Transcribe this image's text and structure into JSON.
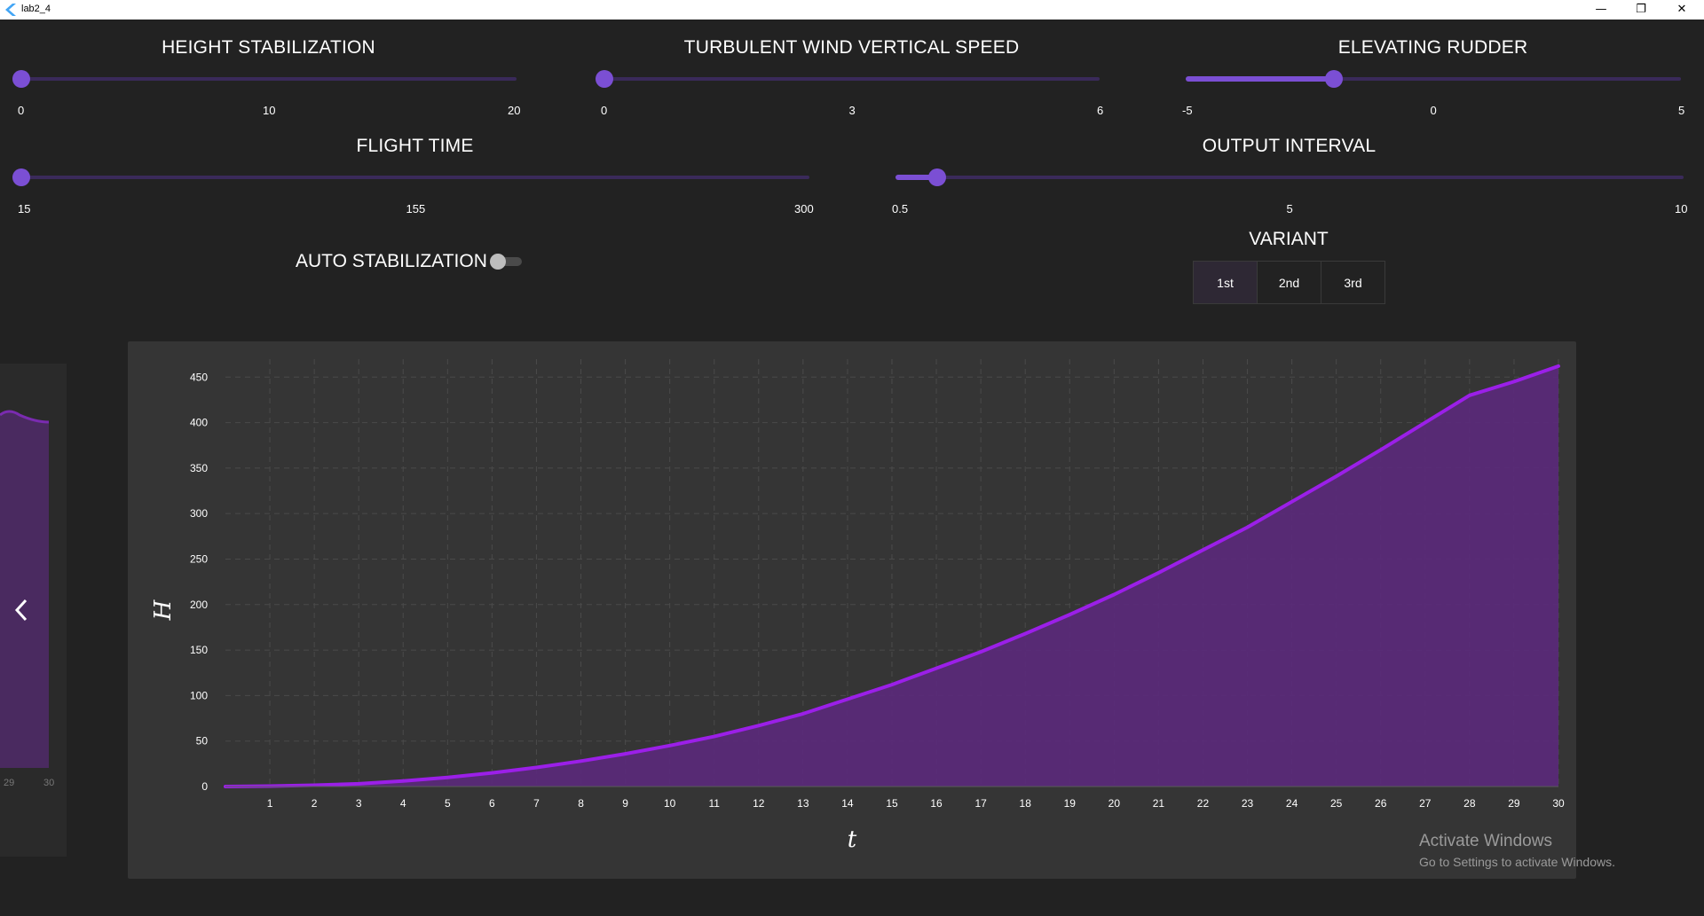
{
  "window": {
    "title": "lab2_4",
    "min_icon": "minimize-icon",
    "max_icon": "maximize-icon",
    "close_icon": "close-icon"
  },
  "sliders": {
    "height_stabilization": {
      "title": "HEIGHT STABILIZATION",
      "min": 0,
      "max": 20,
      "value": 0,
      "labels": [
        "0",
        "10",
        "20"
      ]
    },
    "turbulent_wind": {
      "title": "TURBULENT WIND VERTICAL SPEED",
      "min": 0,
      "max": 6,
      "value": 0,
      "labels": [
        "0",
        "3",
        "6"
      ]
    },
    "elevating_rudder": {
      "title": "ELEVATING RUDDER",
      "min": -5,
      "max": 5,
      "value": -2,
      "labels": [
        "-5",
        "0",
        "5"
      ]
    },
    "flight_time": {
      "title": "FLIGHT TIME",
      "min": 15,
      "max": 300,
      "value": 15,
      "labels": [
        "15",
        "155",
        "300"
      ]
    },
    "output_interval": {
      "title": "OUTPUT INTERVAL",
      "min": 0.5,
      "max": 10,
      "value": 1,
      "labels": [
        "0.5",
        "5",
        "10"
      ]
    }
  },
  "auto_stabilization": {
    "label": "AUTO STABILIZATION",
    "on": false
  },
  "variant": {
    "title": "VARIANT",
    "options": [
      "1st",
      "2nd",
      "3rd"
    ],
    "selected": "1st"
  },
  "side_card": {
    "labels": [
      "29",
      "30"
    ],
    "icon": "chevron-left-icon"
  },
  "chart_data": {
    "type": "area",
    "xlabel": "t",
    "ylabel": "H",
    "xlim": [
      0,
      30
    ],
    "ylim": [
      0,
      460
    ],
    "x_ticks": [
      "1",
      "2",
      "3",
      "4",
      "5",
      "6",
      "7",
      "8",
      "9",
      "10",
      "11",
      "12",
      "13",
      "14",
      "15",
      "16",
      "17",
      "18",
      "19",
      "20",
      "21",
      "22",
      "23",
      "24",
      "25",
      "26",
      "27",
      "28",
      "29",
      "30"
    ],
    "y_ticks": [
      "0",
      "50",
      "100",
      "150",
      "200",
      "250",
      "300",
      "350",
      "400",
      "450"
    ],
    "grid": true,
    "color": "#9b1fe8",
    "fill_color": "#5a2a78",
    "x": [
      0,
      1,
      2,
      3,
      4,
      5,
      6,
      7,
      8,
      9,
      10,
      11,
      12,
      13,
      14,
      15,
      16,
      17,
      18,
      19,
      20,
      21,
      22,
      23,
      24,
      25,
      26,
      27,
      28,
      29,
      30
    ],
    "y": [
      0,
      0.5,
      1.5,
      3,
      6,
      10,
      15,
      21,
      28,
      36,
      45,
      55,
      67,
      80,
      96,
      112,
      130,
      148,
      168,
      189,
      211,
      235,
      260,
      285,
      313,
      341,
      370,
      400,
      430,
      445,
      462
    ]
  },
  "watermark": {
    "line1": "Activate Windows",
    "line2": "Go to Settings to activate Windows."
  },
  "colors": {
    "accent": "#7b4fd4",
    "track": "#3a2a5a",
    "background": "#222222",
    "panel": "#353535"
  }
}
